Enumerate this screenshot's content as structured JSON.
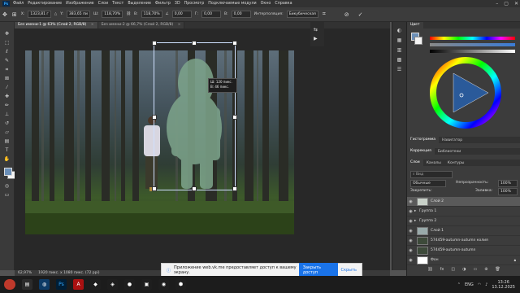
{
  "menubar": {
    "logo": "Ps",
    "items": [
      "Файл",
      "Редактирование",
      "Изображение",
      "Слои",
      "Текст",
      "Выделение",
      "Фильтр",
      "3D",
      "Просмотр",
      "Подключаемые модули",
      "Окно",
      "Справка"
    ]
  },
  "options": {
    "x_value": "1323,81 г",
    "y_value": "383,65 пи",
    "w_value": "118,70%",
    "h_value": "118,70%",
    "angle_value": "0,00",
    "skew_h_value": "0,00",
    "skew_v_value": "0,00",
    "interpolation_label": "Интерполяция:",
    "interpolation_value": "Бикубическая"
  },
  "tabs": [
    {
      "label": "Без имени-1 @ 63% (Слой 2, RGB/8)",
      "close": "×",
      "active": true
    },
    {
      "label": "Без имени-2 @ 66,7% (Слой 2, RGB/8)",
      "close": "×",
      "active": false
    }
  ],
  "canvas": {
    "tooltip_w": "Ш: 120 пикс.",
    "tooltip_h": "В: 46 пикс."
  },
  "status": {
    "zoom": "62,97%",
    "doc_info": "1920 пикс. x 1080 пикс. (72 ppi)"
  },
  "panels": {
    "color_tabs": [
      "Цвет"
    ],
    "hist_tabs": [
      "Гистограмма",
      "Навигатор"
    ],
    "adj_tabs": [
      "Коррекция",
      "Библиотеки"
    ],
    "layer_tabs": [
      "Слои",
      "Каналы",
      "Контуры"
    ],
    "search_placeholder": "Вид",
    "blend_mode": "Обычные",
    "opacity_label": "Непрозрачность:",
    "opacity_value": "100%",
    "lock_label": "Закрепить:",
    "fill_label": "Заливка:",
    "fill_value": "100%",
    "layers": [
      {
        "name": "Слой 2",
        "selected": true
      },
      {
        "name": "Группа 1",
        "selected": false
      },
      {
        "name": "Группа 2",
        "selected": false
      },
      {
        "name": "Слой 1",
        "selected": false
      },
      {
        "name": "574459-autumn-autumn колия",
        "selected": false
      },
      {
        "name": "574459-autumn-autumn",
        "selected": false
      },
      {
        "name": "Фон",
        "selected": false
      }
    ]
  },
  "notification": {
    "message": "Приложение web.vk.me предоставляет доступ к вашему экрану.",
    "share_button": "Закрыть доступ",
    "hide_button": "Скрыть"
  },
  "taskbar": {
    "lang": "ENG",
    "time": "13:26",
    "date": "13.12.2025"
  },
  "colors": {
    "foreground": "#6b8fb8",
    "background": "#f4f4f4",
    "ps_blue": "#31a8ff",
    "selection": "#1a73e8"
  }
}
